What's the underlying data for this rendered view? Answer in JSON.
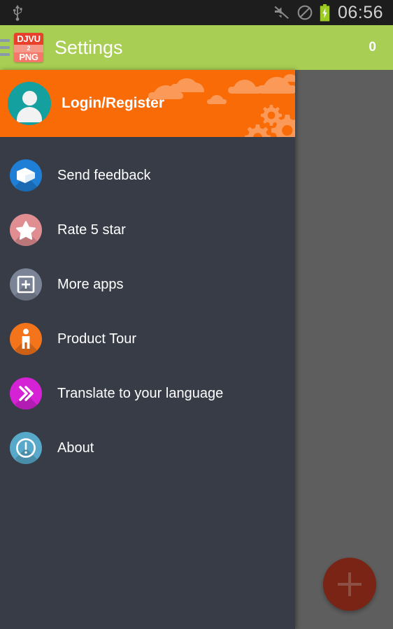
{
  "status_bar": {
    "usb_icon": "usb-icon",
    "mute_icon": "volume-muted-icon",
    "dnd_icon": "do-not-disturb-icon",
    "battery_icon": "battery-charging-icon",
    "time": "06:56",
    "background_color": "#1d1d1d",
    "text_color": "#d2d2d2"
  },
  "action_bar": {
    "menu_icon": "hamburger-menu-icon",
    "app_icon": {
      "name": "djvu2png-app-icon",
      "line1": "DJVU",
      "line2": "2",
      "line3": "PNG"
    },
    "title": "Settings",
    "count": "0",
    "background_color": "#a8ce53",
    "title_color": "#ffffff"
  },
  "drawer": {
    "background_color": "#373c47",
    "header": {
      "avatar_icon": "user-avatar-icon",
      "label": "Login/Register",
      "background_color": "#f96b07",
      "cloud_color": "#fb9a58",
      "gear_icon": "gears-icon",
      "avatar_circle_color": "#15a0a0"
    },
    "items": [
      {
        "label": "Send feedback",
        "icon": "envelope-icon",
        "color": "#1f7fd6"
      },
      {
        "label": "Rate 5 star",
        "icon": "star-icon",
        "color": "#e08e92"
      },
      {
        "label": "More apps",
        "icon": "plus-square-icon",
        "color": "#7b8496"
      },
      {
        "label": "Product Tour",
        "icon": "person-info-icon",
        "color": "#f4741b"
      },
      {
        "label": "Translate to your language",
        "icon": "double-chevron-icon",
        "color": "#d422d4"
      },
      {
        "label": "About",
        "icon": "info-circle-icon",
        "color": "#58a8c9"
      }
    ]
  },
  "main": {
    "scrim_color": "#5e5e5e",
    "fab": {
      "name": "add-fab-button",
      "icon": "plus-icon",
      "color": "#7a2416"
    }
  }
}
